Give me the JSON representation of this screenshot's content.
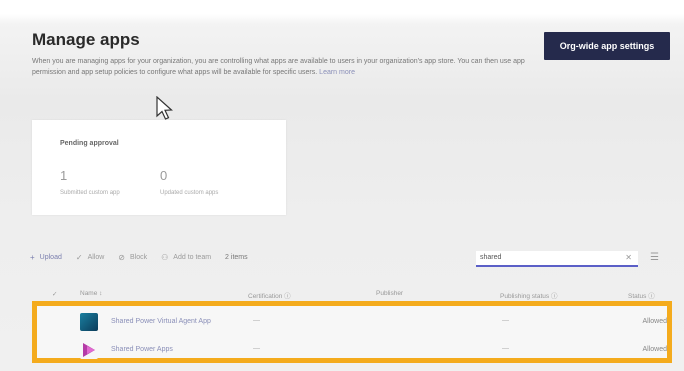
{
  "page": {
    "title": "Manage apps",
    "description": "When you are managing apps for your organization, you are controlling what apps are available to users in your organization's app store. You can then use app permission and app setup policies to configure what apps will be available for specific users.",
    "learn_more": "Learn more",
    "org_button": "Org-wide app settings"
  },
  "card": {
    "title": "Pending approval",
    "stats": [
      {
        "value": "1",
        "label": "Submitted custom app"
      },
      {
        "value": "0",
        "label": "Updated custom apps"
      }
    ]
  },
  "toolbar": {
    "upload": "Upload",
    "allow": "Allow",
    "block": "Block",
    "add_to_team": "Add to team",
    "item_count": "2 items",
    "search_value": "shared"
  },
  "table": {
    "headers": [
      "Name",
      "Certification",
      "Publisher",
      "Publishing status",
      "Status"
    ],
    "rows": [
      {
        "name": "Shared Power Virtual Agent App",
        "certification": "—",
        "publishing": "—",
        "status": "Allowed",
        "icon_color": "#0b4f6c"
      },
      {
        "name": "Shared Power Apps",
        "certification": "—",
        "publishing": "—",
        "status": "Allowed",
        "icon_color": "#b43ba6"
      }
    ]
  },
  "colors": {
    "accent": "#252a4c",
    "highlight": "#f4ab1d"
  }
}
